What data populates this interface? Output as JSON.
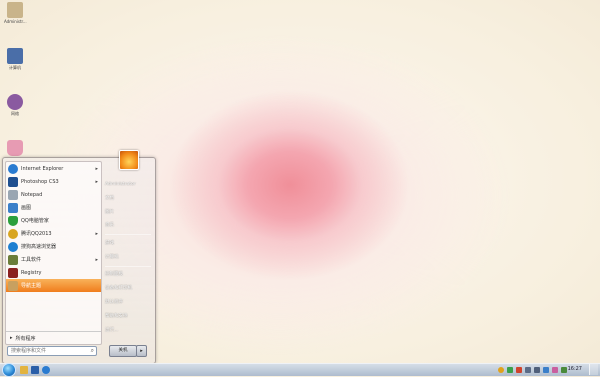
{
  "desktop": {
    "icons": [
      {
        "label": "Administr...",
        "icon": "user-folder-icon",
        "color": "#c9b48a"
      },
      {
        "label": "计算机",
        "icon": "computer-icon",
        "color": "#4a6ea8"
      },
      {
        "label": "网络",
        "icon": "network-icon",
        "color": "#8a5aa0"
      },
      {
        "label": "",
        "icon": "recycle-bin-icon",
        "color": "#e79bb3"
      }
    ]
  },
  "start_menu": {
    "programs": [
      {
        "label": "Internet Explorer",
        "icon": "ie-icon",
        "color": "#2a7bd0",
        "arrow": true
      },
      {
        "label": "Photoshop CS3",
        "icon": "photoshop-icon",
        "color": "#1f4f8f",
        "arrow": true
      },
      {
        "label": "Notepad",
        "icon": "notepad-icon",
        "color": "#9aa6b2",
        "arrow": false
      },
      {
        "label": "画图",
        "icon": "paint-icon",
        "color": "#3b7fc9",
        "arrow": false
      },
      {
        "label": "QQ电脑管家",
        "icon": "guard-icon",
        "color": "#2b9f3c",
        "arrow": false
      },
      {
        "label": "腾讯QQ2013",
        "icon": "qq-icon",
        "color": "#d8a520",
        "arrow": true
      },
      {
        "label": "搜狗高速浏览器",
        "icon": "sogou-icon",
        "color": "#1d7fd1",
        "arrow": false
      },
      {
        "label": "工具软件",
        "icon": "tools-icon",
        "color": "#6b7d3a",
        "arrow": true
      },
      {
        "label": "Registry",
        "icon": "registry-icon",
        "color": "#8a2020",
        "arrow": false
      },
      {
        "label": "导航主题",
        "icon": "theme-icon",
        "color": "#c8a060",
        "arrow": false,
        "active": true
      }
    ],
    "all_programs": "所有程序",
    "search_placeholder": "搜索程序和文件",
    "right_items": [
      "Administrator",
      "文档",
      "图片",
      "音乐",
      "游戏",
      "计算机",
      "控制面板",
      "设备和打印机",
      "默认程序",
      "帮助和支持",
      "运行..."
    ],
    "shutdown_label": "关机"
  },
  "taskbar": {
    "pinned": [
      {
        "icon": "explorer-icon",
        "color": "#e2b33f"
      },
      {
        "icon": "media-icon",
        "color": "#2a5fa8"
      },
      {
        "icon": "ie-icon",
        "color": "#2a7bd0"
      }
    ],
    "tray": [
      {
        "icon": "tray-qq-icon",
        "color": "#e0a21c"
      },
      {
        "icon": "tray-shield-icon",
        "color": "#3aa04a"
      },
      {
        "icon": "tray-flag-icon",
        "color": "#d0432d"
      },
      {
        "icon": "tray-network-icon",
        "color": "#5b6b86"
      },
      {
        "icon": "tray-volume-icon",
        "color": "#4f5f7a"
      },
      {
        "icon": "tray-ime-icon",
        "color": "#3b7fc9"
      },
      {
        "icon": "tray-update-icon",
        "color": "#c95f9f"
      },
      {
        "icon": "tray-power-icon",
        "color": "#4a8a3a"
      }
    ],
    "clock": "16:27"
  }
}
